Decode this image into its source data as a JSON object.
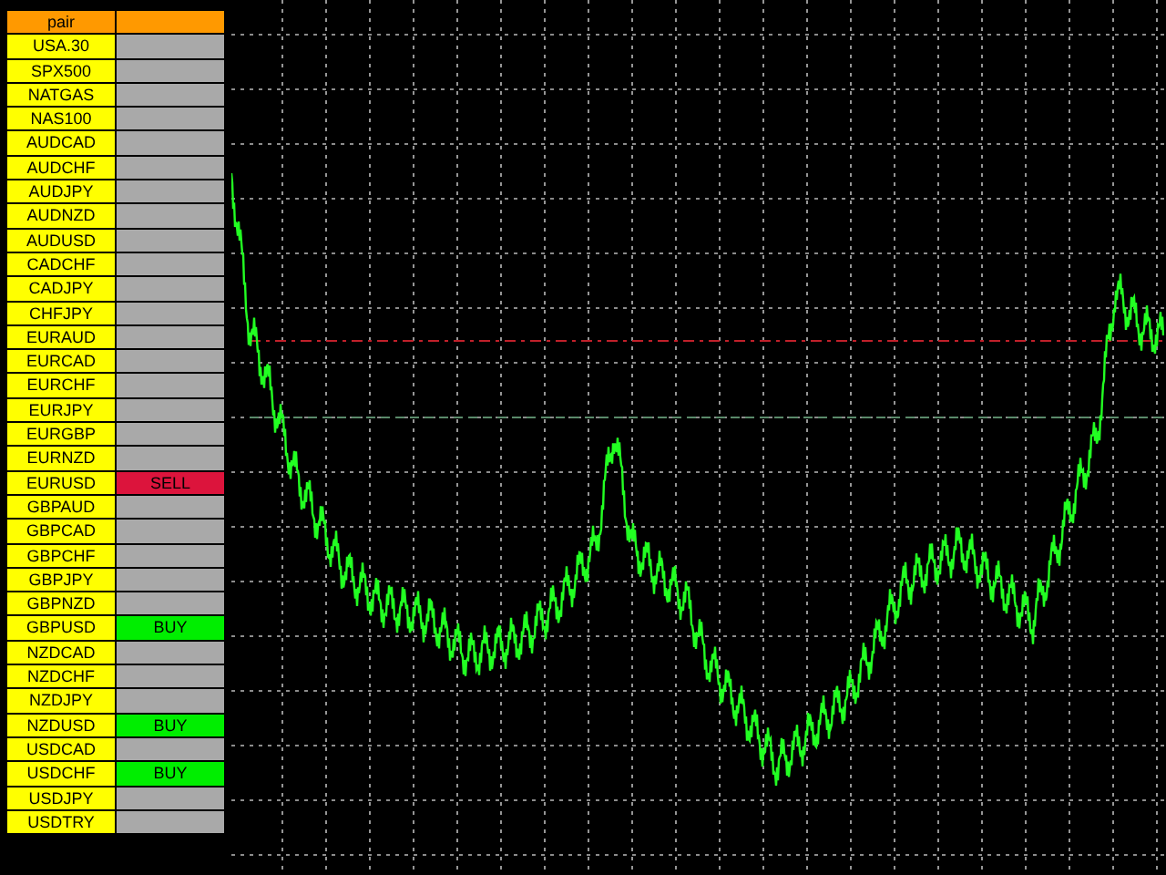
{
  "table": {
    "header": "pair",
    "rows": [
      {
        "pair": "USA.30",
        "kind": "none"
      },
      {
        "pair": "SPX500",
        "kind": "none"
      },
      {
        "pair": "NATGAS",
        "kind": "none"
      },
      {
        "pair": "NAS100",
        "kind": "none"
      },
      {
        "pair": "AUDCAD",
        "kind": "none"
      },
      {
        "pair": "AUDCHF",
        "kind": "none"
      },
      {
        "pair": "AUDJPY",
        "kind": "none"
      },
      {
        "pair": "AUDNZD",
        "kind": "none"
      },
      {
        "pair": "AUDUSD",
        "kind": "none"
      },
      {
        "pair": "CADCHF",
        "kind": "none"
      },
      {
        "pair": "CADJPY",
        "kind": "none"
      },
      {
        "pair": "CHFJPY",
        "kind": "none"
      },
      {
        "pair": "EURAUD",
        "kind": "none"
      },
      {
        "pair": "EURCAD",
        "kind": "none"
      },
      {
        "pair": "EURCHF",
        "kind": "none"
      },
      {
        "pair": "EURJPY",
        "kind": "none"
      },
      {
        "pair": "EURGBP",
        "kind": "none"
      },
      {
        "pair": "EURNZD",
        "kind": "none"
      },
      {
        "pair": "EURUSD",
        "kind": "sell",
        "signal": "SELL"
      },
      {
        "pair": "GBPAUD",
        "kind": "none"
      },
      {
        "pair": "GBPCAD",
        "kind": "none"
      },
      {
        "pair": "GBPCHF",
        "kind": "none"
      },
      {
        "pair": "GBPJPY",
        "kind": "none"
      },
      {
        "pair": "GBPNZD",
        "kind": "none"
      },
      {
        "pair": "GBPUSD",
        "kind": "buy",
        "signal": "BUY"
      },
      {
        "pair": "NZDCAD",
        "kind": "none"
      },
      {
        "pair": "NZDCHF",
        "kind": "none"
      },
      {
        "pair": "NZDJPY",
        "kind": "none"
      },
      {
        "pair": "NZDUSD",
        "kind": "buy",
        "signal": "BUY"
      },
      {
        "pair": "USDCAD",
        "kind": "none"
      },
      {
        "pair": "USDCHF",
        "kind": "buy",
        "signal": "BUY"
      },
      {
        "pair": "USDJPY",
        "kind": "none"
      },
      {
        "pair": "USDTRY",
        "kind": "none"
      }
    ]
  }
}
